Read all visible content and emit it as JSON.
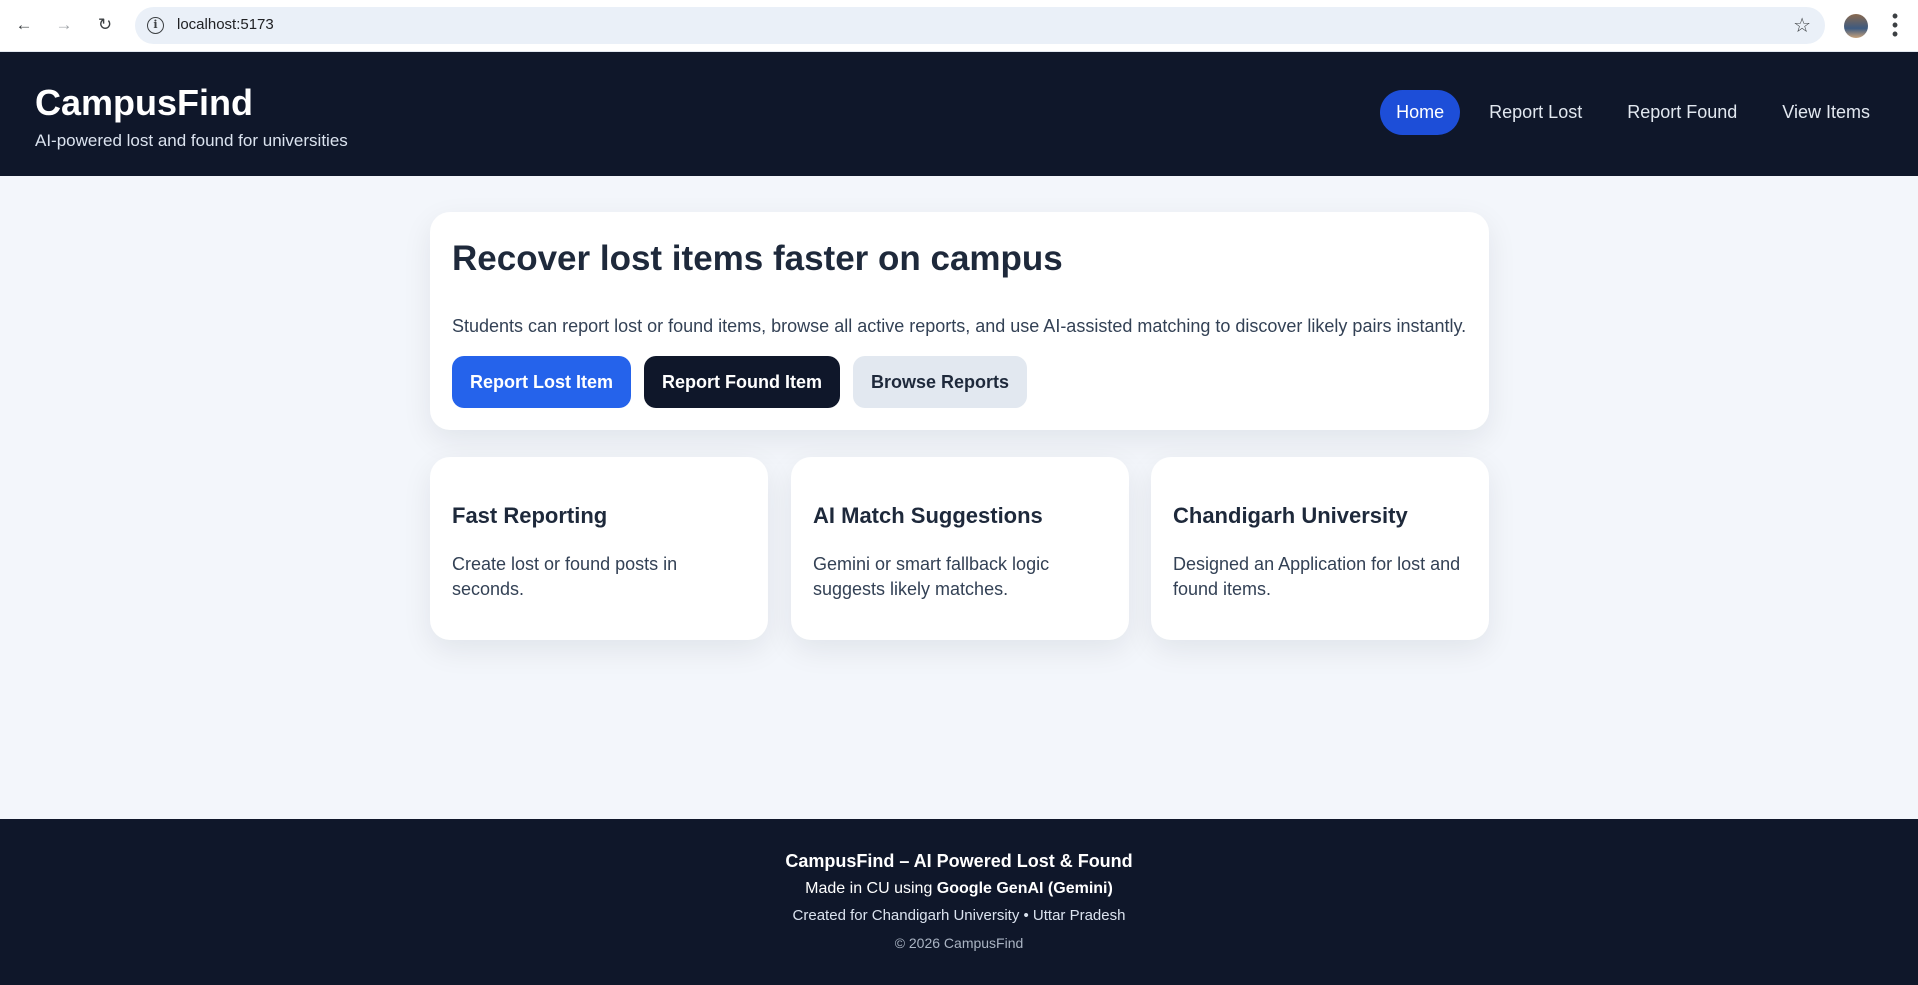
{
  "browser": {
    "url": "localhost:5173"
  },
  "header": {
    "brand": "CampusFind",
    "tagline": "AI-powered lost and found for universities",
    "nav": [
      {
        "label": "Home",
        "active": true
      },
      {
        "label": "Report Lost",
        "active": false
      },
      {
        "label": "Report Found",
        "active": false
      },
      {
        "label": "View Items",
        "active": false
      }
    ]
  },
  "hero": {
    "title": "Recover lost items faster on campus",
    "description": "Students can report lost or found items, browse all active reports, and use AI-assisted matching to discover likely pairs instantly.",
    "buttons": {
      "report_lost": "Report Lost Item",
      "report_found": "Report Found Item",
      "browse": "Browse Reports"
    }
  },
  "features": [
    {
      "title": "Fast Reporting",
      "text": "Create lost or found posts in seconds."
    },
    {
      "title": "AI Match Suggestions",
      "text": "Gemini or smart fallback logic suggests likely matches."
    },
    {
      "title": "Chandigarh University",
      "text": "Designed an Application for lost and found items."
    }
  ],
  "footer": {
    "title": "CampusFind – AI Powered Lost & Found",
    "made_prefix": "Made in CU using ",
    "made_tech": "Google GenAI (Gemini)",
    "created": "Created for Chandigarh University • Uttar Pradesh",
    "copyright": "© 2026 CampusFind"
  },
  "colors": {
    "header_bg": "#0f172a",
    "accent": "#2563eb",
    "nav_active": "#1d4ed8",
    "page_bg": "#f3f6fb"
  }
}
